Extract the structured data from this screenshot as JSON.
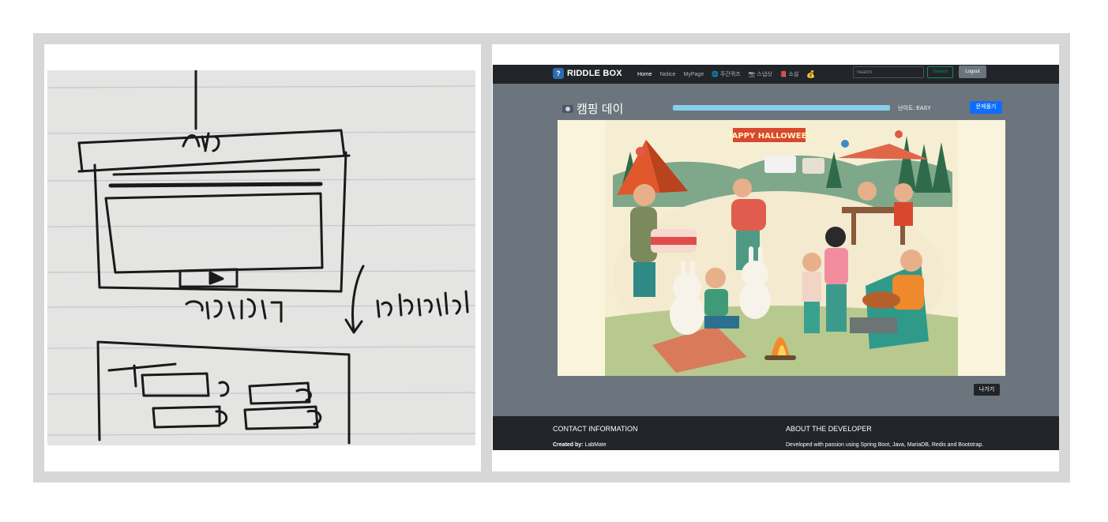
{
  "sketch": {
    "title_text": "새로",
    "label": "문제풀기",
    "redirect_text": "redirect"
  },
  "nav": {
    "brand": "RIDDLE BOX",
    "links": [
      {
        "label": "Home",
        "icon": ""
      },
      {
        "label": "Notice",
        "icon": ""
      },
      {
        "label": "MyPage",
        "icon": ""
      },
      {
        "label": "주간퀴즈",
        "icon": "globe-icon"
      },
      {
        "label": "스냅샷",
        "icon": "camera-icon"
      },
      {
        "label": "소설",
        "icon": "book-icon"
      },
      {
        "label": "",
        "icon": "money-bag-icon"
      }
    ],
    "search_placeholder": "Search",
    "search_button": "Search",
    "logout": "Logout"
  },
  "quiz": {
    "title": "캠핑 데이",
    "progress": 1.0,
    "difficulty_label": "난이도:",
    "difficulty_value": "EASY",
    "solve_button": "문제풀기",
    "image_banner": "HAPPY HALLOWEEN",
    "exit_button": "나가기"
  },
  "footer": {
    "contact_heading": "CONTACT INFORMATION",
    "about_heading": "ABOUT THE DEVELOPER",
    "created_by_label": "Created by:",
    "created_by_value": "LabMate",
    "about_text": "Developed with passion using Spring Boot, Java, MariaDB, Redis and Bootstrap."
  },
  "colors": {
    "navbar": "#212529",
    "page": "#6c757d",
    "primary": "#0d6efd",
    "success": "#198754",
    "progress": "#87ceeb",
    "frame": "#d7d7d7"
  }
}
